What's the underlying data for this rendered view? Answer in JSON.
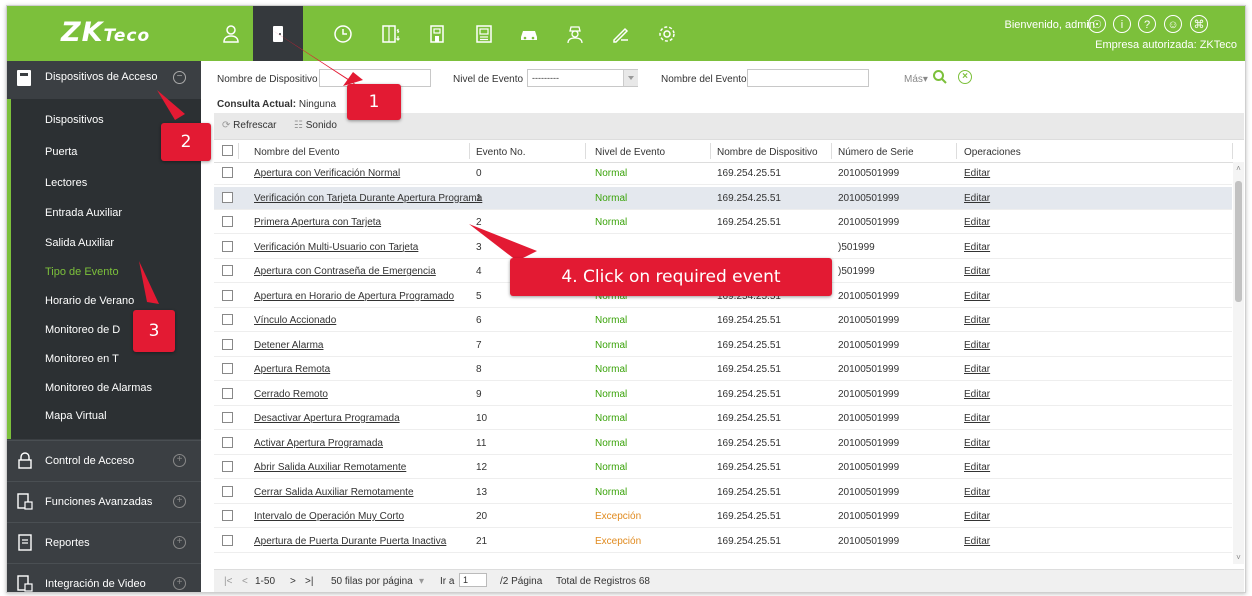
{
  "app": {
    "logo_main": "ZK",
    "logo_tail": "Teco",
    "welcome": "Bienvenido, admin",
    "company": "Empresa autorizada: ZKTeco",
    "accent": "#7cc03b"
  },
  "nav_icons": [
    "person-icon",
    "door-icon",
    "clock-icon",
    "elevator-icon",
    "building-icon",
    "id-card-icon",
    "car-icon",
    "guard-icon",
    "pen-icon",
    "gear-icon"
  ],
  "top_right_icons": [
    "user-circle-icon",
    "info-icon",
    "help-icon",
    "profile-icon",
    "power-icon"
  ],
  "sidebar": {
    "section_title": "Dispositivos de Acceso",
    "items": [
      {
        "label": "Dispositivos"
      },
      {
        "label": "Puerta"
      },
      {
        "label": "Lectores"
      },
      {
        "label": "Entrada Auxiliar"
      },
      {
        "label": "Salida Auxiliar"
      },
      {
        "label": "Tipo de Evento"
      },
      {
        "label": "Horario de Verano"
      },
      {
        "label": "Monitoreo de D"
      },
      {
        "label": "Monitoreo en T"
      },
      {
        "label": "Monitoreo de Alarmas"
      },
      {
        "label": "Mapa Virtual"
      }
    ],
    "groups": [
      {
        "label": "Control de Acceso"
      },
      {
        "label": "Funciones Avanzadas"
      },
      {
        "label": "Reportes"
      },
      {
        "label": "Integración de Video"
      }
    ]
  },
  "filters": {
    "device_label": "Nombre de Dispositivo",
    "device_value": "",
    "level_label": "Nivel de Evento",
    "level_value": "---------",
    "event_label": "Nombre del Evento",
    "event_value": "",
    "more": "Más"
  },
  "consulta": {
    "label": "Consulta Actual:",
    "value": "Ninguna"
  },
  "toolbar": {
    "refresh": "Refrescar",
    "sound": "Sonido"
  },
  "table": {
    "headers": [
      "Nombre del Evento",
      "Evento No.",
      "Nivel de Evento",
      "Nombre de Dispositivo",
      "Número de Serie",
      "Operaciones"
    ],
    "rows": [
      {
        "name": "Apertura con Verificación Normal",
        "no": "0",
        "level": "Normal",
        "device": "169.254.25.51",
        "serial": "20100501999",
        "op": "Editar"
      },
      {
        "name": "Verificación con Tarjeta Durante Apertura Programa",
        "no": "1",
        "level": "Normal",
        "device": "169.254.25.51",
        "serial": "20100501999",
        "op": "Editar"
      },
      {
        "name": "Primera Apertura con Tarjeta",
        "no": "2",
        "level": "Normal",
        "device": "169.254.25.51",
        "serial": "20100501999",
        "op": "Editar"
      },
      {
        "name": "Verificación Multi-Usuario con Tarjeta",
        "no": "3",
        "level": "",
        "device": "",
        "serial": ")501999",
        "op": "Editar"
      },
      {
        "name": "Apertura con Contraseña de Emergencia",
        "no": "4",
        "level": "",
        "device": "",
        "serial": ")501999",
        "op": "Editar"
      },
      {
        "name": "Apertura en Horario de Apertura Programado",
        "no": "5",
        "level": "Normal",
        "device": "169.254.25.51",
        "serial": "20100501999",
        "op": "Editar"
      },
      {
        "name": "Vínculo Accionado",
        "no": "6",
        "level": "Normal",
        "device": "169.254.25.51",
        "serial": "20100501999",
        "op": "Editar"
      },
      {
        "name": "Detener Alarma",
        "no": "7",
        "level": "Normal",
        "device": "169.254.25.51",
        "serial": "20100501999",
        "op": "Editar"
      },
      {
        "name": "Apertura Remota",
        "no": "8",
        "level": "Normal",
        "device": "169.254.25.51",
        "serial": "20100501999",
        "op": "Editar"
      },
      {
        "name": "Cerrado Remoto",
        "no": "9",
        "level": "Normal",
        "device": "169.254.25.51",
        "serial": "20100501999",
        "op": "Editar"
      },
      {
        "name": "Desactivar Apertura Programada",
        "no": "10",
        "level": "Normal",
        "device": "169.254.25.51",
        "serial": "20100501999",
        "op": "Editar"
      },
      {
        "name": "Activar Apertura Programada",
        "no": "11",
        "level": "Normal",
        "device": "169.254.25.51",
        "serial": "20100501999",
        "op": "Editar"
      },
      {
        "name": "Abrir Salida Auxiliar Remotamente",
        "no": "12",
        "level": "Normal",
        "device": "169.254.25.51",
        "serial": "20100501999",
        "op": "Editar"
      },
      {
        "name": "Cerrar Salida Auxiliar Remotamente",
        "no": "13",
        "level": "Normal",
        "device": "169.254.25.51",
        "serial": "20100501999",
        "op": "Editar"
      },
      {
        "name": "Intervalo de Operación Muy Corto",
        "no": "20",
        "level": "Excepción",
        "device": "169.254.25.51",
        "serial": "20100501999",
        "op": "Editar"
      },
      {
        "name": "Apertura de Puerta Durante Puerta Inactiva",
        "no": "21",
        "level": "Excepción",
        "device": "169.254.25.51",
        "serial": "20100501999",
        "op": "Editar"
      }
    ]
  },
  "pager": {
    "range": "1-50",
    "per_page": "50 filas por página",
    "goto_label": "Ir a",
    "goto_value": "1",
    "pages": "/2 Página",
    "total": "Total de Registros 68"
  },
  "callouts": {
    "one": "1",
    "two": "2",
    "three": "3",
    "four": "4. Click on required event",
    "color": "#e31a33"
  }
}
